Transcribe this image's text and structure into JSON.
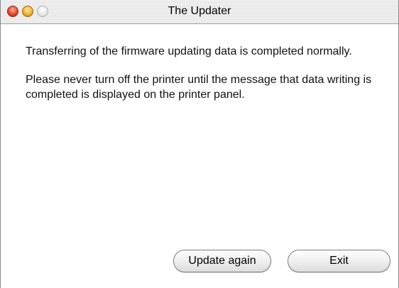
{
  "window": {
    "title": "The Updater"
  },
  "message": {
    "line1": "Transferring of the firmware updating data is completed normally.",
    "line2": "Please never turn off the printer until the message that data writing is completed is displayed on the printer panel."
  },
  "buttons": {
    "update_again": "Update again",
    "exit": "Exit"
  },
  "colors": {
    "close": "#e8462f",
    "minimize": "#f2b232",
    "zoom": "#e6e6e6"
  }
}
